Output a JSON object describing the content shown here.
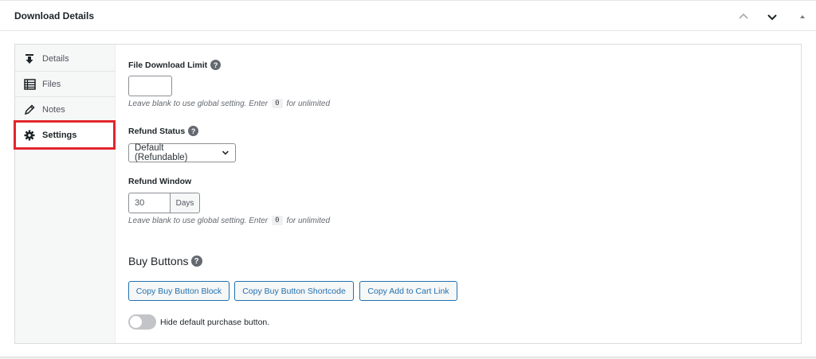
{
  "header": {
    "title": "Download Details",
    "icons": [
      "chevron-up-icon",
      "chevron-down-icon",
      "triangle-up-icon"
    ]
  },
  "tabs": [
    {
      "label": "Details",
      "icon": "download-icon"
    },
    {
      "label": "Files",
      "icon": "files-list-icon"
    },
    {
      "label": "Notes",
      "icon": "pencil-icon"
    },
    {
      "label": "Settings",
      "icon": "gear-icon",
      "active": true
    }
  ],
  "settings": {
    "download_limit": {
      "label": "File Download Limit",
      "value": "",
      "help_text_before": "Leave blank to use global setting. Enter",
      "help_code": "0",
      "help_text_after": "for unlimited"
    },
    "refund_status": {
      "label": "Refund Status",
      "selected": "Default (Refundable)"
    },
    "refund_window": {
      "label": "Refund Window",
      "value": "30",
      "unit": "Days",
      "help_text_before": "Leave blank to use global setting. Enter",
      "help_code": "0",
      "help_text_after": "for unlimited"
    },
    "buy_buttons": {
      "title": "Buy Buttons",
      "buttons": [
        "Copy Buy Button Block",
        "Copy Buy Button Shortcode",
        "Copy Add to Cart Link"
      ],
      "toggle_label": "Hide default purchase button.",
      "toggle_on": false
    }
  },
  "colors": {
    "accent": "#2271b1",
    "highlight": "#e1262d"
  }
}
